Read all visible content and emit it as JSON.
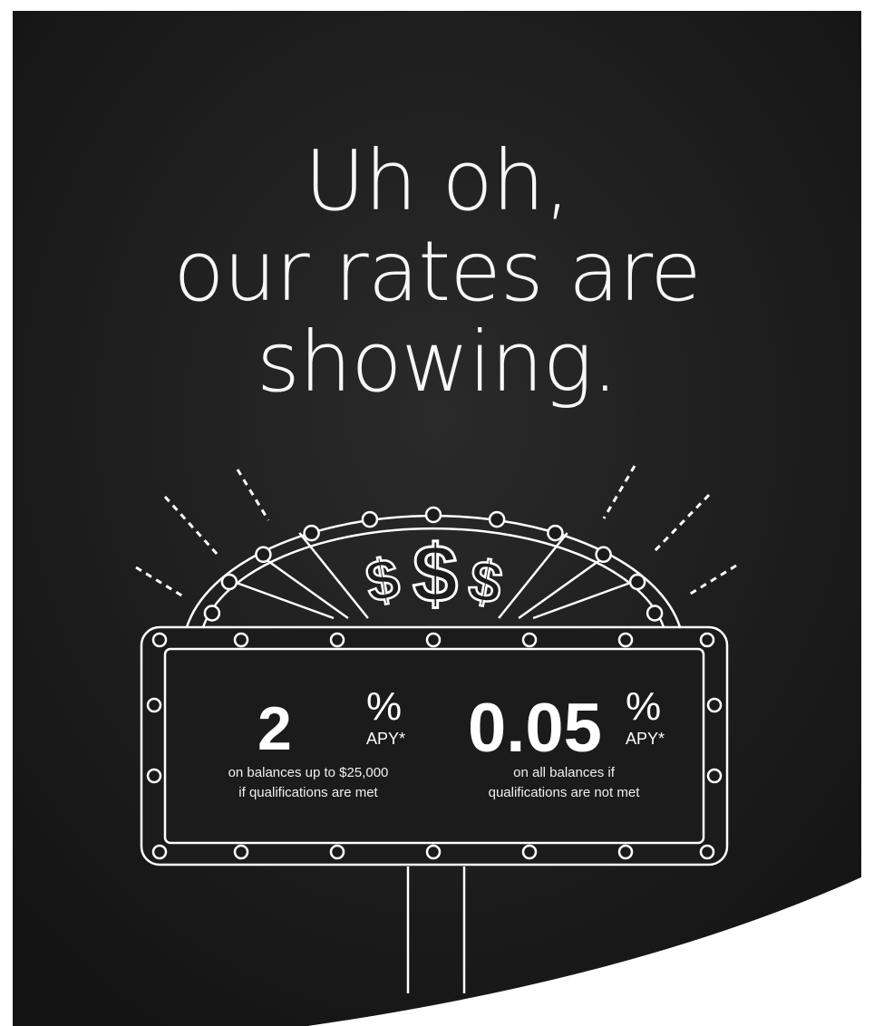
{
  "headline": {
    "line1": "Uh oh,",
    "line2": "our rates are",
    "line3": "showing."
  },
  "offers": [
    {
      "rate": "2",
      "percent_sign": "%",
      "unit": "APY*",
      "note_line1": "on balances up to $25,000",
      "note_line2": "if qualifications are met"
    },
    {
      "rate": "0.05",
      "percent_sign": "%",
      "unit": "APY*",
      "note_line1": "on all balances if",
      "note_line2": "qualifications are not met"
    }
  ],
  "wheel_symbols": [
    "$",
    "$",
    "$"
  ],
  "colors": {
    "background": "#1c1c1c",
    "line_art": "#ffffff",
    "page": "#ffffff"
  }
}
